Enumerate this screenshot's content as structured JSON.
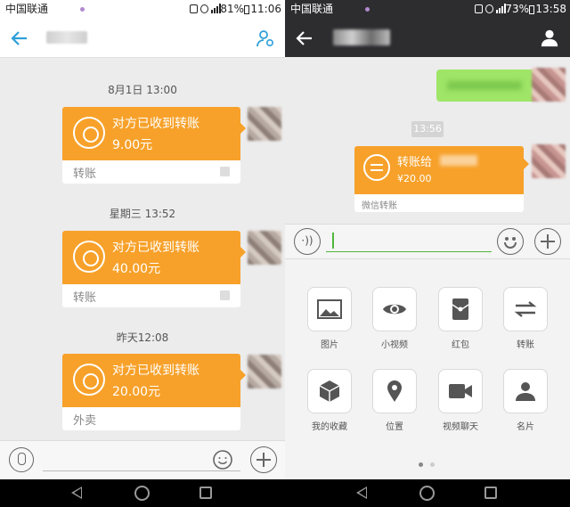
{
  "left": {
    "status": {
      "carrier": "中国联通",
      "battery": "81%",
      "time": "11:06"
    },
    "messages": [
      {
        "time": "8月1日 13:00",
        "title": "对方已收到转账",
        "amount": "9.00元",
        "footer": "转账"
      },
      {
        "time": "星期三 13:52",
        "title": "对方已收到转账",
        "amount": "40.00元",
        "footer": "转账"
      },
      {
        "time": "昨天12:08",
        "title": "对方已收到转账",
        "amount": "20.00元",
        "footer": "外卖"
      }
    ]
  },
  "right": {
    "status": {
      "carrier": "中国联通",
      "battery": "73%",
      "time": "13:58"
    },
    "timestamp": "13:56",
    "transfer": {
      "title": "转账给",
      "amount": "¥20.00",
      "footer": "微信转账"
    },
    "voice_label": "·))",
    "panel": [
      {
        "label": "图片",
        "icon": "image-icon"
      },
      {
        "label": "小视频",
        "icon": "eye-icon"
      },
      {
        "label": "红包",
        "icon": "red-envelope-icon"
      },
      {
        "label": "转账",
        "icon": "transfer-icon"
      },
      {
        "label": "我的收藏",
        "icon": "favorites-cube-icon"
      },
      {
        "label": "位置",
        "icon": "location-pin-icon"
      },
      {
        "label": "视频聊天",
        "icon": "video-camera-icon"
      },
      {
        "label": "名片",
        "icon": "contact-card-icon"
      }
    ]
  },
  "colors": {
    "accent_orange": "#f7a12a",
    "header_dark": "#2d2d30",
    "bubble_green": "#9fe567",
    "qq_blue": "#2f9fd9",
    "wechat_green": "#4fb839"
  }
}
